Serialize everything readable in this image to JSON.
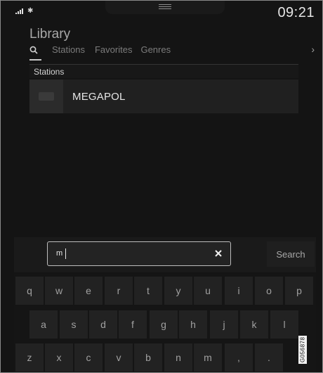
{
  "status": {
    "bluetooth_icon": "bluetooth-icon",
    "signal_icon": "signal-strength-icon",
    "time": "09:21"
  },
  "header": {
    "title": "Library",
    "tabs": [
      {
        "label": "Stations"
      },
      {
        "label": "Favorites"
      },
      {
        "label": "Genres"
      }
    ],
    "search_tab_icon": "search-icon",
    "next_icon": "chevron-right-icon"
  },
  "results": {
    "section_label": "Stations",
    "items": [
      {
        "name": "MEGAPOL"
      }
    ]
  },
  "search": {
    "value": "m",
    "clear_icon": "close-icon",
    "button_label": "Search"
  },
  "keyboard": {
    "row1": [
      "q",
      "w",
      "e",
      "r",
      "t",
      "y",
      "u",
      "i",
      "o",
      "p"
    ],
    "row2": [
      "a",
      "s",
      "d",
      "f",
      "g",
      "h",
      "j",
      "k",
      "l"
    ],
    "row3": [
      "z",
      "x",
      "c",
      "v",
      "b",
      "n",
      "m",
      ",",
      "."
    ]
  },
  "watermark": "G056878",
  "colors": {
    "background": "#141414",
    "text_primary": "#e6e6e6",
    "text_muted": "#7c7c7c"
  }
}
